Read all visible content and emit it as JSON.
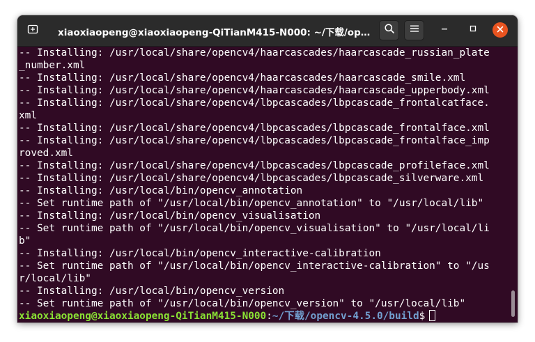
{
  "window": {
    "title": "xiaoxiaopeng@xiaoxiaopeng-QiTianM415-N000: ~/下载/opencv-4.5.0/build"
  },
  "icons": {
    "new_tab": "new-tab-icon",
    "search": "search-icon",
    "menu": "hamburger-menu-icon",
    "minimize": "minimize-icon",
    "maximize": "maximize-icon",
    "close": "close-icon"
  },
  "colors": {
    "terminal_bg": "#300a24",
    "prompt_user": "#8ae234",
    "prompt_path": "#729fcf",
    "close_button": "#e95420"
  },
  "terminal": {
    "lines": [
      "-- Installing: /usr/local/share/opencv4/haarcascades/haarcascade_russian_plate",
      "_number.xml",
      "-- Installing: /usr/local/share/opencv4/haarcascades/haarcascade_smile.xml",
      "-- Installing: /usr/local/share/opencv4/haarcascades/haarcascade_upperbody.xml",
      "-- Installing: /usr/local/share/opencv4/lbpcascades/lbpcascade_frontalcatface.",
      "xml",
      "-- Installing: /usr/local/share/opencv4/lbpcascades/lbpcascade_frontalface.xml",
      "-- Installing: /usr/local/share/opencv4/lbpcascades/lbpcascade_frontalface_imp",
      "roved.xml",
      "-- Installing: /usr/local/share/opencv4/lbpcascades/lbpcascade_profileface.xml",
      "-- Installing: /usr/local/share/opencv4/lbpcascades/lbpcascade_silverware.xml",
      "-- Installing: /usr/local/bin/opencv_annotation",
      "-- Set runtime path of \"/usr/local/bin/opencv_annotation\" to \"/usr/local/lib\"",
      "-- Installing: /usr/local/bin/opencv_visualisation",
      "-- Set runtime path of \"/usr/local/bin/opencv_visualisation\" to \"/usr/local/li",
      "b\"",
      "-- Installing: /usr/local/bin/opencv_interactive-calibration",
      "-- Set runtime path of \"/usr/local/bin/opencv_interactive-calibration\" to \"/us",
      "r/local/lib\"",
      "-- Installing: /usr/local/bin/opencv_version",
      "-- Set runtime path of \"/usr/local/bin/opencv_version\" to \"/usr/local/lib\""
    ],
    "prompt": {
      "user_host": "xiaoxiaopeng@xiaoxiaopeng-QiTianM415-N000",
      "separator": ":",
      "path": "~/下载/opencv-4.5.0/build",
      "symbol": "$"
    }
  }
}
